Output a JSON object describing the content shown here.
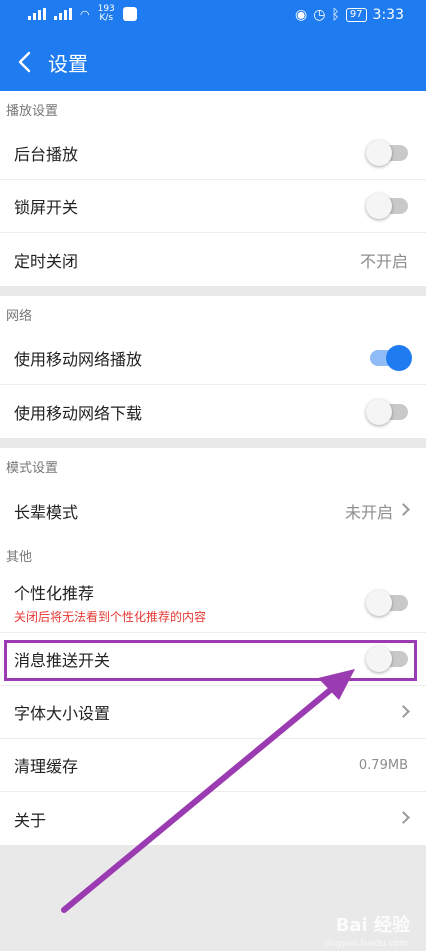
{
  "status_bar": {
    "speed_value": "193",
    "speed_unit": "K/s",
    "battery": "97",
    "time": "3:33",
    "accent": "#ffffff"
  },
  "header": {
    "title": "设置",
    "back_icon": "chevron-left-icon",
    "color": "#1f7cf0"
  },
  "sections": {
    "playback": {
      "title": "播放设置",
      "background_play": {
        "label": "后台播放",
        "toggle_on": false
      },
      "lock_screen": {
        "label": "锁屏开关",
        "toggle_on": false
      },
      "timer_off": {
        "label": "定时关闭",
        "value": "不开启"
      }
    },
    "network": {
      "title": "网络",
      "mobile_play": {
        "label": "使用移动网络播放",
        "toggle_on": true
      },
      "mobile_download": {
        "label": "使用移动网络下载",
        "toggle_on": false
      }
    },
    "mode": {
      "title": "模式设置",
      "elder_mode": {
        "label": "长辈模式",
        "value": "未开启"
      }
    },
    "other": {
      "title": "其他",
      "personalized": {
        "label": "个性化推荐",
        "subtitle": "关闭后将无法看到个性化推荐的内容",
        "toggle_on": false
      },
      "push": {
        "label": "消息推送开关",
        "toggle_on": false
      },
      "font_size": {
        "label": "字体大小设置"
      },
      "clear_cache": {
        "label": "清理缓存",
        "value": "0.79MB"
      },
      "about": {
        "label": "关于"
      }
    }
  },
  "annotation": {
    "highlight_color": "#9b3bb2"
  },
  "watermark": {
    "text": "Bai 经验",
    "sub": "jingyan.baidu.com"
  }
}
